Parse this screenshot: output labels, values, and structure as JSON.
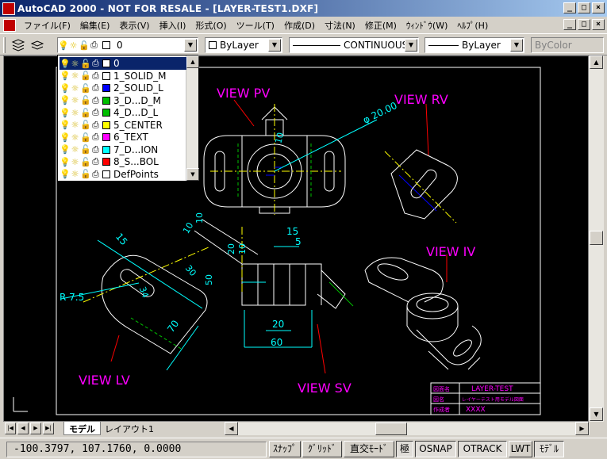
{
  "window": {
    "title": "AutoCAD 2000 - NOT FOR RESALE - [LAYER-TEST1.DXF]"
  },
  "window_buttons": {
    "minimize": "_",
    "maximize": "□",
    "close": "×"
  },
  "menu": [
    "ファイル(F)",
    "編集(E)",
    "表示(V)",
    "挿入(I)",
    "形式(O)",
    "ツール(T)",
    "作成(D)",
    "寸法(N)",
    "修正(M)",
    "ｳｨﾝﾄﾞｳ(W)",
    "ﾍﾙﾌﾟ(H)"
  ],
  "toolbar": {
    "layer_current": "0",
    "color": "ByLayer",
    "linetype": "CONTINUOUS",
    "lineweight": "ByLayer",
    "plotstyle": "ByColor"
  },
  "layers": [
    {
      "name": "0",
      "color": "#ffffff"
    },
    {
      "name": "1_SOLID_M",
      "color": "#ffffff"
    },
    {
      "name": "2_SOLID_L",
      "color": "#0000ff"
    },
    {
      "name": "3_D...D_M",
      "color": "#00c000"
    },
    {
      "name": "4_D...D_L",
      "color": "#00c000"
    },
    {
      "name": "5_CENTER",
      "color": "#ffff00"
    },
    {
      "name": "6_TEXT",
      "color": "#ff00ff"
    },
    {
      "name": "7_D...ION",
      "color": "#00ffff"
    },
    {
      "name": "8_S...BOL",
      "color": "#ff0000"
    },
    {
      "name": "DefPoints",
      "color": "#ffffff"
    }
  ],
  "drawing": {
    "views": [
      "VIEW PV",
      "VIEW RV",
      "VIEW IV",
      "VIEW LV",
      "VIEW SV"
    ],
    "dims": {
      "diameter": "φ 20.00",
      "d10a": "10",
      "d10b": "10",
      "d10c": "10",
      "d20": "20",
      "d15top": "15",
      "d5": "5",
      "d30": "30",
      "d50": "50",
      "d20b": "20",
      "d60": "60",
      "r75": "R 7.5",
      "d70": "70",
      "d15lv": "15",
      "d34": "34",
      "d30lv": "30",
      "d10d": "10"
    },
    "titleblock": {
      "label1": "図面名",
      "value1": "LAYER-TEST",
      "label2": "図名",
      "value2": "レイヤーテスト用モデル図面",
      "label3": "作成者",
      "value3": "XXXX"
    }
  },
  "tabs": {
    "model": "モデル",
    "layout": "レイアウト1"
  },
  "tab_nav": [
    "|◀",
    "◀",
    "▶",
    "▶|"
  ],
  "status": {
    "coords": "-100.3797, 107.1760, 0.0000",
    "modes": [
      {
        "label": "ｽﾅｯﾌﾟ",
        "on": false
      },
      {
        "label": "ｸﾞﾘｯﾄﾞ",
        "on": false
      },
      {
        "label": "直交ﾓｰﾄﾞ",
        "on": false
      },
      {
        "label": "極",
        "on": true
      },
      {
        "label": "OSNAP",
        "on": true
      },
      {
        "label": "OTRACK",
        "on": true
      },
      {
        "label": "LWT",
        "on": false
      },
      {
        "label": "ﾓﾃﾞﾙ",
        "on": true
      }
    ]
  }
}
